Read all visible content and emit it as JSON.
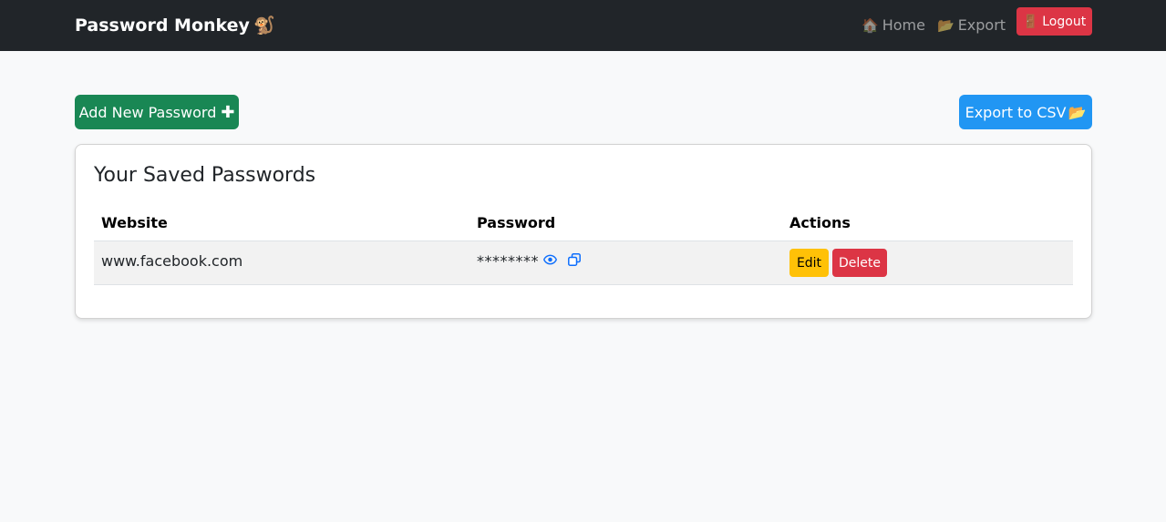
{
  "navbar": {
    "brand": "Password Monkey",
    "brand_emoji": "🐒",
    "links": [
      {
        "icon": "🏠",
        "icon_name": "home-icon",
        "label": "Home"
      },
      {
        "icon": "📂",
        "icon_name": "folder-icon",
        "label": "Export"
      }
    ],
    "logout": {
      "icon": "🚪",
      "icon_name": "door-icon",
      "label": "Logout"
    }
  },
  "actions": {
    "add_label": "Add New Password",
    "add_icon": "✚",
    "export_label": "Export to CSV",
    "export_icon": "📂"
  },
  "card": {
    "title": "Your Saved Passwords",
    "columns": [
      "Website",
      "Password",
      "Actions"
    ],
    "rows": [
      {
        "website": "www.facebook.com",
        "password": "********",
        "edit_label": "Edit",
        "delete_label": "Delete"
      }
    ]
  },
  "colors": {
    "navbar_bg": "#212529",
    "add_button": "#198754",
    "export_button": "#2196f3",
    "edit_button": "#ffc107",
    "delete_button": "#dc3545",
    "icon_accent": "#0d6efd"
  }
}
